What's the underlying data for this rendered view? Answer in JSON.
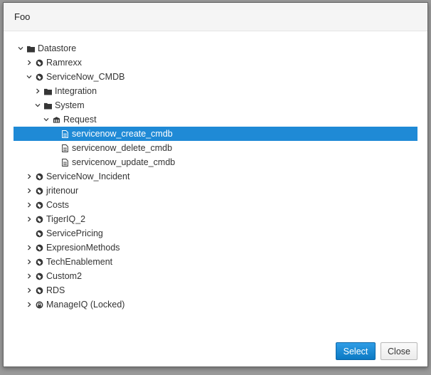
{
  "dialog": {
    "title": "Foo",
    "select_label": "Select",
    "close_label": "Close"
  },
  "tree": [
    {
      "label": "Datastore",
      "depth": 0,
      "toggle": "expanded",
      "icon": "folder-icon"
    },
    {
      "label": "Ramrexx",
      "depth": 1,
      "toggle": "collapsed",
      "icon": "globe-icon"
    },
    {
      "label": "ServiceNow_CMDB",
      "depth": 1,
      "toggle": "expanded",
      "icon": "globe-icon"
    },
    {
      "label": "Integration",
      "depth": 2,
      "toggle": "collapsed",
      "icon": "folder-icon"
    },
    {
      "label": "System",
      "depth": 2,
      "toggle": "expanded",
      "icon": "folder-icon"
    },
    {
      "label": "Request",
      "depth": 3,
      "toggle": "expanded",
      "icon": "class-icon"
    },
    {
      "label": "servicenow_create_cmdb",
      "depth": 4,
      "toggle": "none",
      "icon": "file-icon",
      "selected": true
    },
    {
      "label": "servicenow_delete_cmdb",
      "depth": 4,
      "toggle": "none",
      "icon": "file-icon"
    },
    {
      "label": "servicenow_update_cmdb",
      "depth": 4,
      "toggle": "none",
      "icon": "file-icon"
    },
    {
      "label": "ServiceNow_Incident",
      "depth": 1,
      "toggle": "collapsed",
      "icon": "globe-icon"
    },
    {
      "label": "jritenour",
      "depth": 1,
      "toggle": "collapsed",
      "icon": "globe-icon"
    },
    {
      "label": "Costs",
      "depth": 1,
      "toggle": "collapsed",
      "icon": "globe-icon"
    },
    {
      "label": "TigerIQ_2",
      "depth": 1,
      "toggle": "collapsed",
      "icon": "globe-icon"
    },
    {
      "label": "ServicePricing",
      "depth": 1,
      "toggle": "none",
      "icon": "globe-icon"
    },
    {
      "label": "ExpresionMethods",
      "depth": 1,
      "toggle": "collapsed",
      "icon": "globe-icon"
    },
    {
      "label": "TechEnablement",
      "depth": 1,
      "toggle": "collapsed",
      "icon": "globe-icon"
    },
    {
      "label": "Custom2",
      "depth": 1,
      "toggle": "collapsed",
      "icon": "globe-icon"
    },
    {
      "label": "RDS",
      "depth": 1,
      "toggle": "collapsed",
      "icon": "globe-icon"
    },
    {
      "label": "ManageIQ (Locked)",
      "depth": 1,
      "toggle": "collapsed",
      "icon": "locked-domain-icon"
    }
  ],
  "colors": {
    "selected_bg": "#1f8ad6",
    "primary_button": "#0e83d2"
  }
}
